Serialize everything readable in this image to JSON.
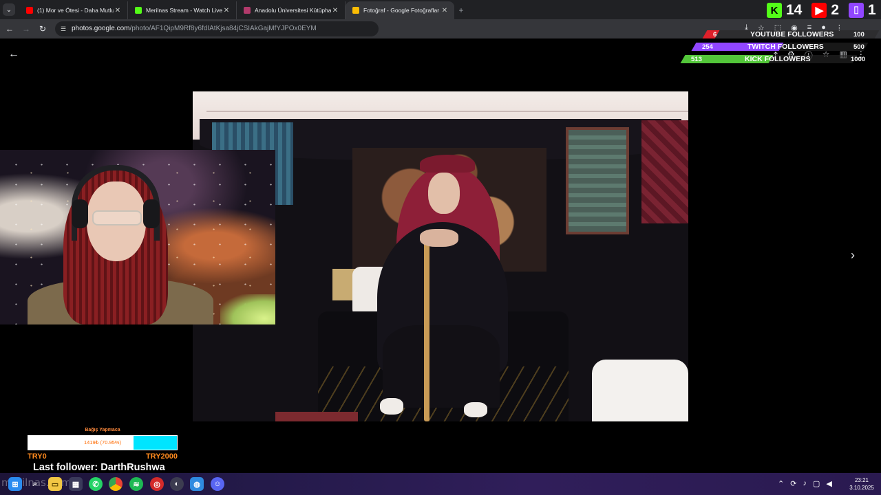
{
  "browser": {
    "tabs": [
      {
        "title": "(1) Mor ve Ötesi - Daha Mutlu",
        "favicon_color": "#ff0000",
        "active": false
      },
      {
        "title": "Merilnas Stream - Watch Live o",
        "favicon_color": "#53fc18",
        "active": false
      },
      {
        "title": "Anadolu Üniversitesi Kütüphan",
        "favicon_color": "#b23a6b",
        "active": false
      },
      {
        "title": "Fotoğraf - Google Fotoğraflar",
        "favicon_color": "#fbbc04",
        "active": true
      }
    ],
    "close_glyph": "✕",
    "new_tab_glyph": "+",
    "url_host": "photos.google.com",
    "url_path": "/photo/AF1QipM9Rf8y6fdIAtKjsa84jCSIAkGajMfYJPOx0EYM"
  },
  "stream_overlay": {
    "top_counters": [
      {
        "platform": "kick",
        "value": "14",
        "color": "#53fc18",
        "glyph": "K"
      },
      {
        "platform": "youtube",
        "value": "2",
        "color": "#ff0000",
        "glyph": "▶"
      },
      {
        "platform": "twitch",
        "value": "1",
        "color": "#9146ff",
        "glyph": "⌷"
      }
    ],
    "followers": [
      {
        "label": "YOUTUBE FOLLOWERS",
        "current": "6",
        "goal": "100",
        "color": "#e0202a"
      },
      {
        "label": "TWITCH FOLLOWERS",
        "current": "254",
        "goal": "500",
        "color": "#9146ff"
      },
      {
        "label": "KICK FOLLOWERS",
        "current": "513",
        "goal": "1000",
        "color": "#53c63a"
      }
    ],
    "donation": {
      "title": "Bağış Yapmaca",
      "progress_text": "1419₺ (70.95%)",
      "progress_fraction": 0.7095,
      "min_label": "TRY0",
      "max_label": "TRY2000"
    },
    "last_follower": "Last follower: DarthRushwa"
  },
  "viewer": {
    "back_glyph": "←",
    "next_glyph": "›"
  },
  "taskbar": {
    "watermark": "merilnas.com",
    "time": "23:21",
    "date": "3.10.2025"
  }
}
